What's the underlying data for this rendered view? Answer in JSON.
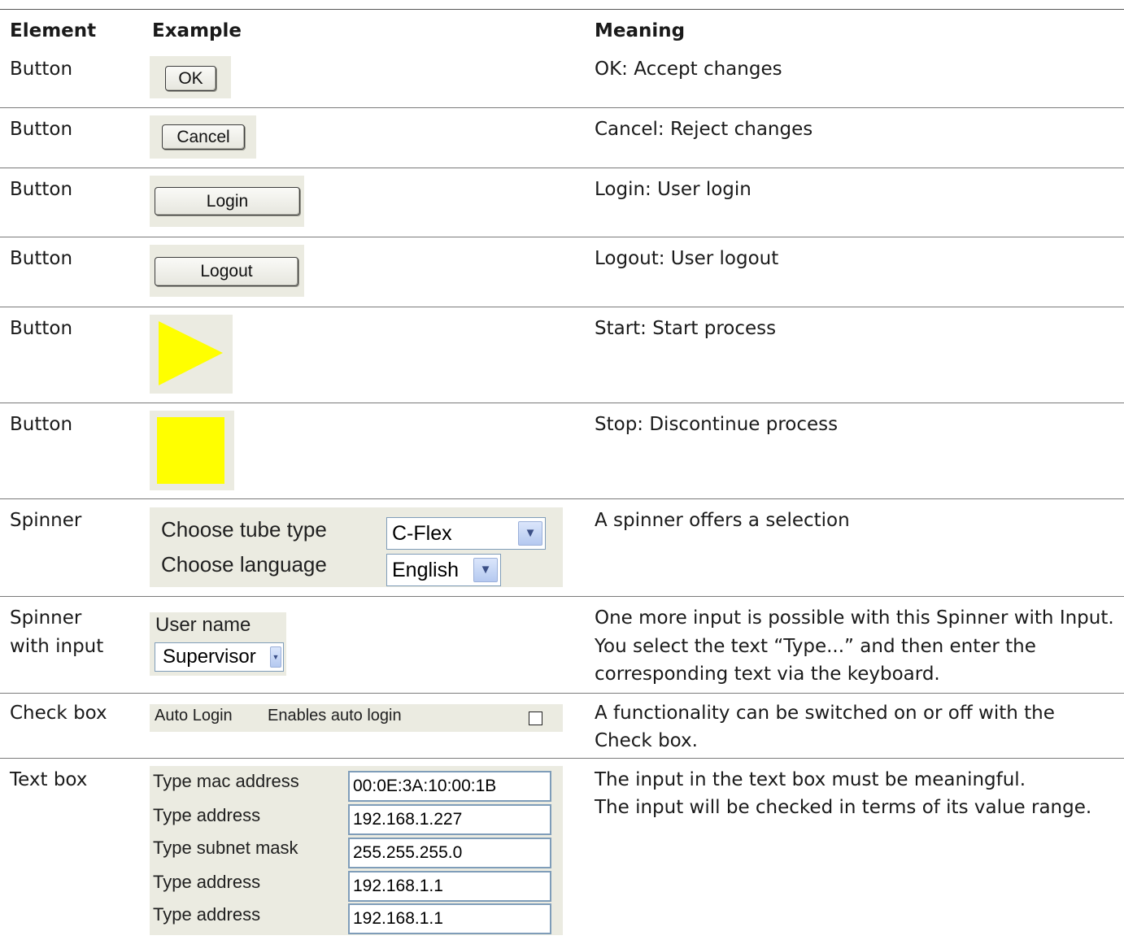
{
  "header": {
    "element": "Element",
    "example": "Example",
    "meaning": "Meaning"
  },
  "rows": [
    {
      "element": "Button",
      "meaning": "OK: Accept changes",
      "button_label": "OK"
    },
    {
      "element": "Button",
      "meaning": "Cancel: Reject changes",
      "button_label": "Cancel"
    },
    {
      "element": "Button",
      "meaning": "Login: User login",
      "button_label": "Login"
    },
    {
      "element": "Button",
      "meaning": "Logout: User logout",
      "button_label": "Logout"
    },
    {
      "element": "Button",
      "meaning": "Start: Start process",
      "icon": "play-triangle-icon"
    },
    {
      "element": "Button",
      "meaning": "Stop: Discontinue process",
      "icon": "stop-square-icon"
    },
    {
      "element": "Spinner",
      "meaning": "A spinner offers a selection",
      "tube_label": "Choose tube type",
      "tube_value": "C-Flex",
      "lang_label": "Choose language",
      "lang_value": "English"
    },
    {
      "element_line1": "Spinner",
      "element_line2": "with input",
      "meaning_line1": "One more input is possible with this Spinner with Input.",
      "meaning_line2": "You select the text “Type...” and then enter the",
      "meaning_line3": "corresponding text via the keyboard.",
      "label": "User name",
      "value": "Supervisor"
    },
    {
      "element": "Check box",
      "meaning_line1": "A functionality can be switched on or off with the",
      "meaning_line2": "Check box.",
      "label": "Auto Login",
      "description": "Enables auto login",
      "checked": false
    },
    {
      "element": "Text box",
      "meaning_line1": "The input in the text box must be meaningful.",
      "meaning_line2": "The input will be checked in terms of its value range.",
      "fields": [
        {
          "label": "Type mac address",
          "value": "00:0E:3A:10:00:1B"
        },
        {
          "label": "Type address",
          "value": "192.168.1.227"
        },
        {
          "label": "Type subnet mask",
          "value": "255.255.255.0"
        },
        {
          "label": "Type address",
          "value": "192.168.1.1"
        },
        {
          "label": "Type address",
          "value": "192.168.1.1"
        }
      ]
    }
  ],
  "colors": {
    "panel": "#ebebe1",
    "yellow": "#ffff00",
    "rule": "#7a7a7a"
  }
}
